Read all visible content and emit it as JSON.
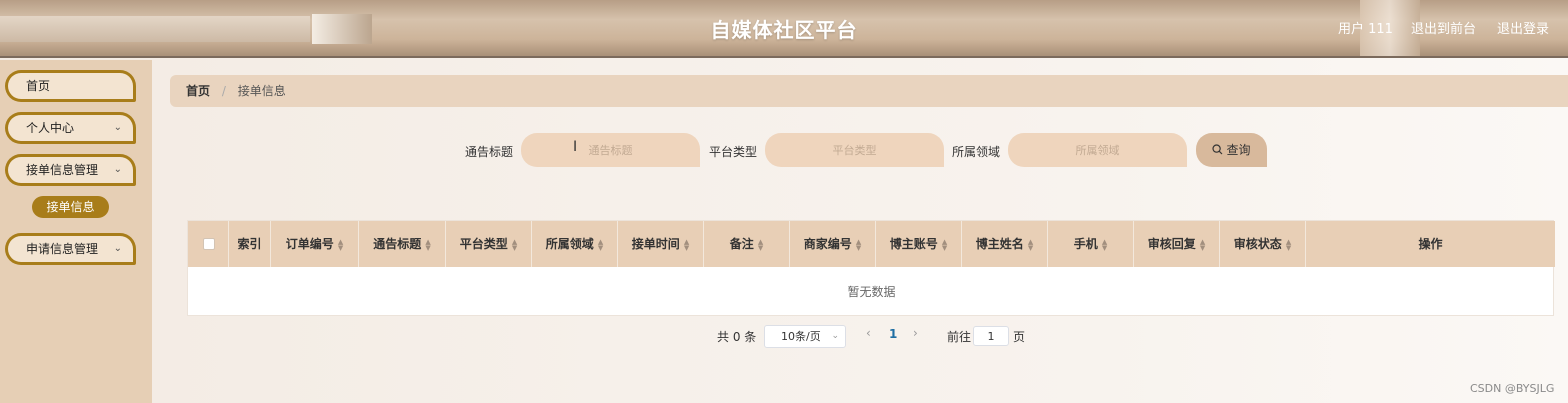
{
  "header": {
    "title": "自媒体社区平台",
    "user": "用户 111",
    "to_front": "退出到前台",
    "logout": "退出登录"
  },
  "sidebar": {
    "items": [
      {
        "label": "首页",
        "has_children": false
      },
      {
        "label": "个人中心",
        "has_children": true
      },
      {
        "label": "接单信息管理",
        "has_children": true,
        "children": [
          "接单信息"
        ]
      },
      {
        "label": "申请信息管理",
        "has_children": true
      }
    ]
  },
  "breadcrumb": {
    "home": "首页",
    "separator": "/",
    "current": "接单信息"
  },
  "search": {
    "fields": [
      {
        "label": "通告标题",
        "placeholder": "通告标题"
      },
      {
        "label": "平台类型",
        "placeholder": "平台类型"
      },
      {
        "label": "所属领域",
        "placeholder": "所属领域"
      }
    ],
    "button_label": "查询",
    "button_icon": "search-icon"
  },
  "table": {
    "columns": [
      "索引",
      "订单编号",
      "通告标题",
      "平台类型",
      "所属领域",
      "接单时间",
      "备注",
      "商家编号",
      "博主账号",
      "博主姓名",
      "手机",
      "审核回复",
      "审核状态",
      "操作"
    ],
    "empty_text": "暂无数据"
  },
  "pagination": {
    "total": "共 0 条",
    "page_size": "10条/页",
    "current_page": "1",
    "goto_label": "前往",
    "goto_value": "1",
    "page_suffix": "页"
  },
  "watermark": "CSDN @BYSJLG",
  "colors": {
    "accent": "#a87d1a",
    "header_bg": "#cdb49a",
    "sidebar_bg": "#e6cfb5",
    "table_header_bg": "#e8cfb6"
  }
}
